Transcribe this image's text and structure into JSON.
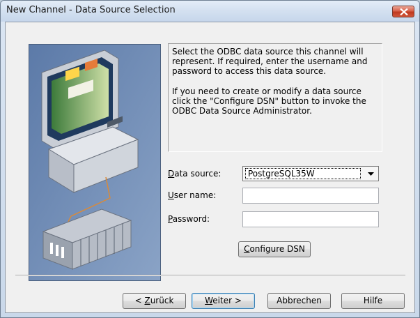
{
  "window": {
    "title": "New Channel - Data Source Selection"
  },
  "description": {
    "paragraph1": "Select the ODBC data source this channel will\nrepresent.  If required, enter the username and\npassword to access this data source.",
    "paragraph2": "If you need to create or modify a data source\nclick the \"Configure DSN\" button to invoke the\nODBC Data Source Administrator."
  },
  "form": {
    "data_source_label": {
      "mnemonic": "D",
      "rest": "ata source:"
    },
    "data_source_value": "PostgreSQL35W",
    "user_name_label": {
      "mnemonic": "U",
      "rest": "ser name:"
    },
    "user_name_value": "",
    "password_label": {
      "mnemonic": "P",
      "rest": "assword:"
    },
    "password_value": "",
    "configure_button": {
      "mnemonic": "C",
      "rest": "onfigure DSN"
    }
  },
  "footer": {
    "back_button": {
      "prefix": "< ",
      "mnemonic": "Z",
      "rest": "urück"
    },
    "next_button": {
      "mnemonic": "W",
      "rest": "eiter >"
    },
    "cancel_label": "Abbrechen",
    "help_label": "Hilfe"
  },
  "colors": {
    "illustration_background": "#6d8ab4",
    "close_button": "#c0391f",
    "default_button_border": "#3c7fb1"
  },
  "icons": {
    "close": "close-icon",
    "dropdown": "chevron-down-icon",
    "illustration": "computer-plc-illustration"
  }
}
